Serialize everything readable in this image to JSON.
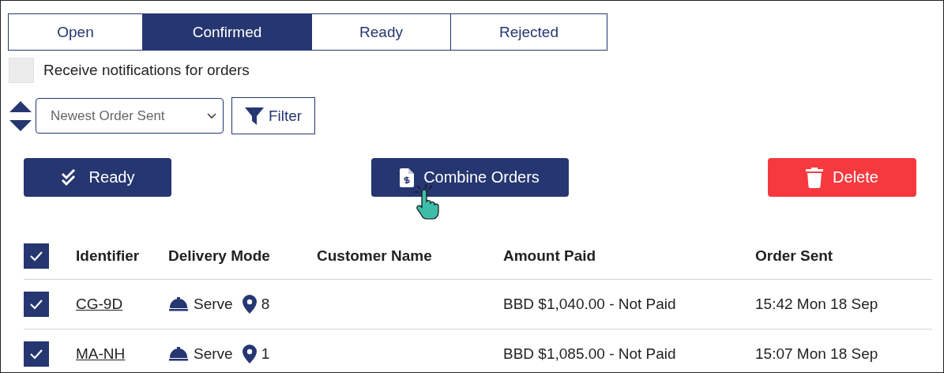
{
  "tabs": [
    {
      "label": "Open",
      "selected": false
    },
    {
      "label": "Confirmed",
      "selected": true
    },
    {
      "label": "Ready",
      "selected": false
    },
    {
      "label": "Rejected",
      "selected": false
    }
  ],
  "notifications": {
    "label": "Receive notifications for orders",
    "checked": false
  },
  "sort": {
    "value": "Newest Order Sent"
  },
  "filter_button": {
    "label": "Filter"
  },
  "actions": [
    {
      "label": "Ready",
      "kind": "ready"
    },
    {
      "label": "Combine Orders",
      "kind": "combine"
    },
    {
      "label": "Delete",
      "kind": "delete"
    }
  ],
  "table": {
    "select_all": true,
    "columns": [
      "Identifier",
      "Delivery Mode",
      "Customer Name",
      "Amount Paid",
      "Order Sent"
    ],
    "rows": [
      {
        "selected": true,
        "identifier": "CG-9D",
        "delivery_mode": "Serve",
        "table_number": "8",
        "amount_paid": "BBD $1,040.00 - Not Paid",
        "order_sent": "15:42 Mon 18 Sep"
      },
      {
        "selected": true,
        "identifier": "MA-NH",
        "delivery_mode": "Serve",
        "table_number": "1",
        "amount_paid": "BBD $1,085.00 - Not Paid",
        "order_sent": "15:07 Mon 18 Sep"
      }
    ]
  }
}
